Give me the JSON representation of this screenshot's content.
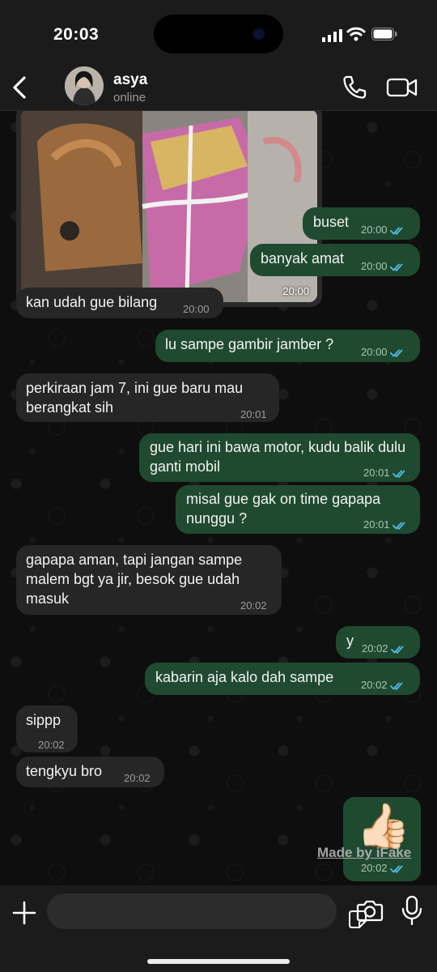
{
  "status_bar": {
    "time": "20:03"
  },
  "header": {
    "contact_name": "asya",
    "presence": "online"
  },
  "image_message": {
    "time": "20:00"
  },
  "messages": [
    {
      "text": "buset",
      "time": "20:00"
    },
    {
      "text": "banyak amat",
      "time": "20:00"
    },
    {
      "text": "kan udah gue bilang",
      "time": "20:00"
    },
    {
      "text": "lu sampe gambir jamber ?",
      "time": "20:00"
    },
    {
      "text": "perkiraan jam 7, ini gue baru mau berangkat sih",
      "time": "20:01"
    },
    {
      "text": "gue hari ini bawa motor, kudu balik dulu ganti mobil",
      "time": "20:01"
    },
    {
      "text": "misal gue gak on time gapapa nunggu ?",
      "time": "20:01"
    },
    {
      "text": "gapapa aman, tapi jangan sampe malem bgt ya jir, besok gue udah masuk",
      "time": "20:02"
    },
    {
      "text": "y",
      "time": "20:02"
    },
    {
      "text": "kabarin aja kalo dah sampe",
      "time": "20:02"
    },
    {
      "text": "sippp",
      "time": "20:02"
    },
    {
      "text": "tengkyu bro",
      "time": "20:02"
    }
  ],
  "emoji_message": {
    "emoji": "👍🏻",
    "time": "20:02"
  },
  "watermark": "Made by iFake",
  "colors": {
    "outgoing": "#1f4a30",
    "incoming": "#262626",
    "read_ticks": "#53bdeb"
  },
  "icons": [
    "back-chevron-icon",
    "phone-icon",
    "video-camera-icon",
    "plus-icon",
    "sticker-icon",
    "camera-icon",
    "microphone-icon"
  ]
}
